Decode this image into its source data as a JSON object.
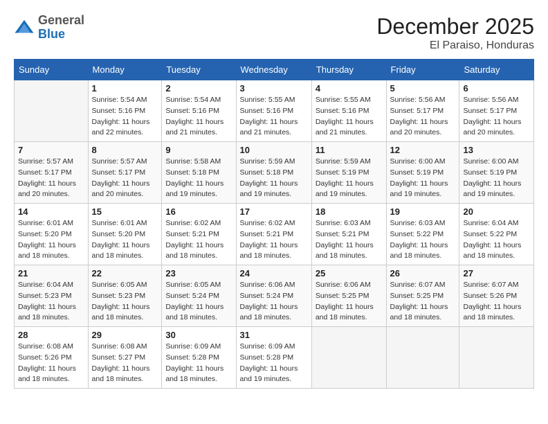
{
  "header": {
    "logo_general": "General",
    "logo_blue": "Blue",
    "month_year": "December 2025",
    "location": "El Paraiso, Honduras"
  },
  "columns": [
    "Sunday",
    "Monday",
    "Tuesday",
    "Wednesday",
    "Thursday",
    "Friday",
    "Saturday"
  ],
  "weeks": [
    [
      {
        "day": "",
        "info": ""
      },
      {
        "day": "1",
        "info": "Sunrise: 5:54 AM\nSunset: 5:16 PM\nDaylight: 11 hours and 22 minutes."
      },
      {
        "day": "2",
        "info": "Sunrise: 5:54 AM\nSunset: 5:16 PM\nDaylight: 11 hours and 21 minutes."
      },
      {
        "day": "3",
        "info": "Sunrise: 5:55 AM\nSunset: 5:16 PM\nDaylight: 11 hours and 21 minutes."
      },
      {
        "day": "4",
        "info": "Sunrise: 5:55 AM\nSunset: 5:16 PM\nDaylight: 11 hours and 21 minutes."
      },
      {
        "day": "5",
        "info": "Sunrise: 5:56 AM\nSunset: 5:17 PM\nDaylight: 11 hours and 20 minutes."
      },
      {
        "day": "6",
        "info": "Sunrise: 5:56 AM\nSunset: 5:17 PM\nDaylight: 11 hours and 20 minutes."
      }
    ],
    [
      {
        "day": "7",
        "info": "Sunrise: 5:57 AM\nSunset: 5:17 PM\nDaylight: 11 hours and 20 minutes."
      },
      {
        "day": "8",
        "info": "Sunrise: 5:57 AM\nSunset: 5:17 PM\nDaylight: 11 hours and 20 minutes."
      },
      {
        "day": "9",
        "info": "Sunrise: 5:58 AM\nSunset: 5:18 PM\nDaylight: 11 hours and 19 minutes."
      },
      {
        "day": "10",
        "info": "Sunrise: 5:59 AM\nSunset: 5:18 PM\nDaylight: 11 hours and 19 minutes."
      },
      {
        "day": "11",
        "info": "Sunrise: 5:59 AM\nSunset: 5:19 PM\nDaylight: 11 hours and 19 minutes."
      },
      {
        "day": "12",
        "info": "Sunrise: 6:00 AM\nSunset: 5:19 PM\nDaylight: 11 hours and 19 minutes."
      },
      {
        "day": "13",
        "info": "Sunrise: 6:00 AM\nSunset: 5:19 PM\nDaylight: 11 hours and 19 minutes."
      }
    ],
    [
      {
        "day": "14",
        "info": "Sunrise: 6:01 AM\nSunset: 5:20 PM\nDaylight: 11 hours and 18 minutes."
      },
      {
        "day": "15",
        "info": "Sunrise: 6:01 AM\nSunset: 5:20 PM\nDaylight: 11 hours and 18 minutes."
      },
      {
        "day": "16",
        "info": "Sunrise: 6:02 AM\nSunset: 5:21 PM\nDaylight: 11 hours and 18 minutes."
      },
      {
        "day": "17",
        "info": "Sunrise: 6:02 AM\nSunset: 5:21 PM\nDaylight: 11 hours and 18 minutes."
      },
      {
        "day": "18",
        "info": "Sunrise: 6:03 AM\nSunset: 5:21 PM\nDaylight: 11 hours and 18 minutes."
      },
      {
        "day": "19",
        "info": "Sunrise: 6:03 AM\nSunset: 5:22 PM\nDaylight: 11 hours and 18 minutes."
      },
      {
        "day": "20",
        "info": "Sunrise: 6:04 AM\nSunset: 5:22 PM\nDaylight: 11 hours and 18 minutes."
      }
    ],
    [
      {
        "day": "21",
        "info": "Sunrise: 6:04 AM\nSunset: 5:23 PM\nDaylight: 11 hours and 18 minutes."
      },
      {
        "day": "22",
        "info": "Sunrise: 6:05 AM\nSunset: 5:23 PM\nDaylight: 11 hours and 18 minutes."
      },
      {
        "day": "23",
        "info": "Sunrise: 6:05 AM\nSunset: 5:24 PM\nDaylight: 11 hours and 18 minutes."
      },
      {
        "day": "24",
        "info": "Sunrise: 6:06 AM\nSunset: 5:24 PM\nDaylight: 11 hours and 18 minutes."
      },
      {
        "day": "25",
        "info": "Sunrise: 6:06 AM\nSunset: 5:25 PM\nDaylight: 11 hours and 18 minutes."
      },
      {
        "day": "26",
        "info": "Sunrise: 6:07 AM\nSunset: 5:25 PM\nDaylight: 11 hours and 18 minutes."
      },
      {
        "day": "27",
        "info": "Sunrise: 6:07 AM\nSunset: 5:26 PM\nDaylight: 11 hours and 18 minutes."
      }
    ],
    [
      {
        "day": "28",
        "info": "Sunrise: 6:08 AM\nSunset: 5:26 PM\nDaylight: 11 hours and 18 minutes."
      },
      {
        "day": "29",
        "info": "Sunrise: 6:08 AM\nSunset: 5:27 PM\nDaylight: 11 hours and 18 minutes."
      },
      {
        "day": "30",
        "info": "Sunrise: 6:09 AM\nSunset: 5:28 PM\nDaylight: 11 hours and 18 minutes."
      },
      {
        "day": "31",
        "info": "Sunrise: 6:09 AM\nSunset: 5:28 PM\nDaylight: 11 hours and 19 minutes."
      },
      {
        "day": "",
        "info": ""
      },
      {
        "day": "",
        "info": ""
      },
      {
        "day": "",
        "info": ""
      }
    ]
  ]
}
